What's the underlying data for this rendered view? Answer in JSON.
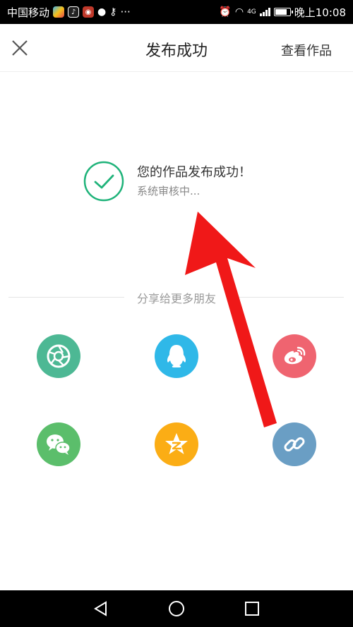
{
  "status_bar": {
    "carrier": "中国移动",
    "more": "···",
    "network": "4G",
    "time": "晚上10:08",
    "battery_level": 0.8
  },
  "header": {
    "title": "发布成功",
    "action": "查看作品",
    "close_icon": "close-icon"
  },
  "success": {
    "message": "您的作品发布成功！",
    "status": "系统审核中...",
    "icon": "check-circle-icon",
    "color": "#1fb37a"
  },
  "share": {
    "label": "分享给更多朋友",
    "targets": [
      {
        "name": "moments",
        "icon": "camera-aperture-icon",
        "color": "#4db894"
      },
      {
        "name": "qq",
        "icon": "penguin-icon",
        "color": "#2fb8e8"
      },
      {
        "name": "weibo",
        "icon": "weibo-icon",
        "color": "#ef6470"
      },
      {
        "name": "wechat",
        "icon": "wechat-icon",
        "color": "#5bbe6b"
      },
      {
        "name": "qzone",
        "icon": "star-icon",
        "color": "#fbad15"
      },
      {
        "name": "copy-link",
        "icon": "link-icon",
        "color": "#6a9ec4"
      }
    ]
  },
  "annotation": {
    "arrow_color": "#f01818"
  },
  "nav_bar": {
    "back_icon": "back-triangle-icon",
    "home_icon": "home-circle-icon",
    "recents_icon": "recents-square-icon"
  }
}
